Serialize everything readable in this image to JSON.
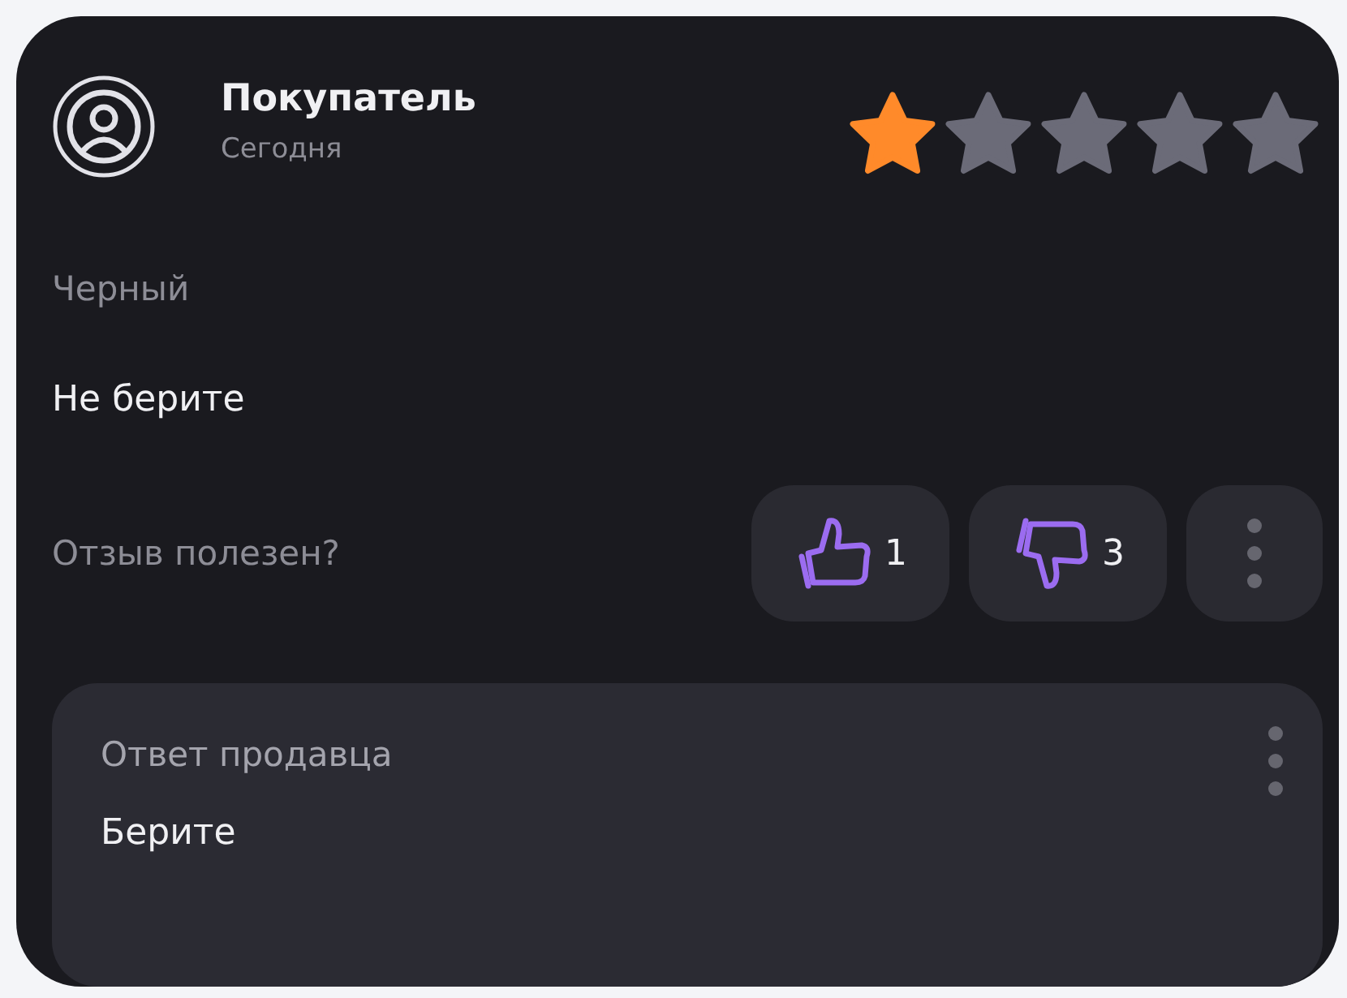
{
  "review": {
    "author": "Покупатель",
    "date": "Сегодня",
    "stars": 1,
    "variant": "Черный",
    "text": "Не берите",
    "helpful_prompt": "Отзыв полезен?",
    "votes": [
      {
        "kind": "like",
        "count": "1"
      },
      {
        "kind": "dislike",
        "count": "3"
      }
    ],
    "seller_reply": {
      "title": "Ответ продавца",
      "text": "Берите"
    }
  }
}
